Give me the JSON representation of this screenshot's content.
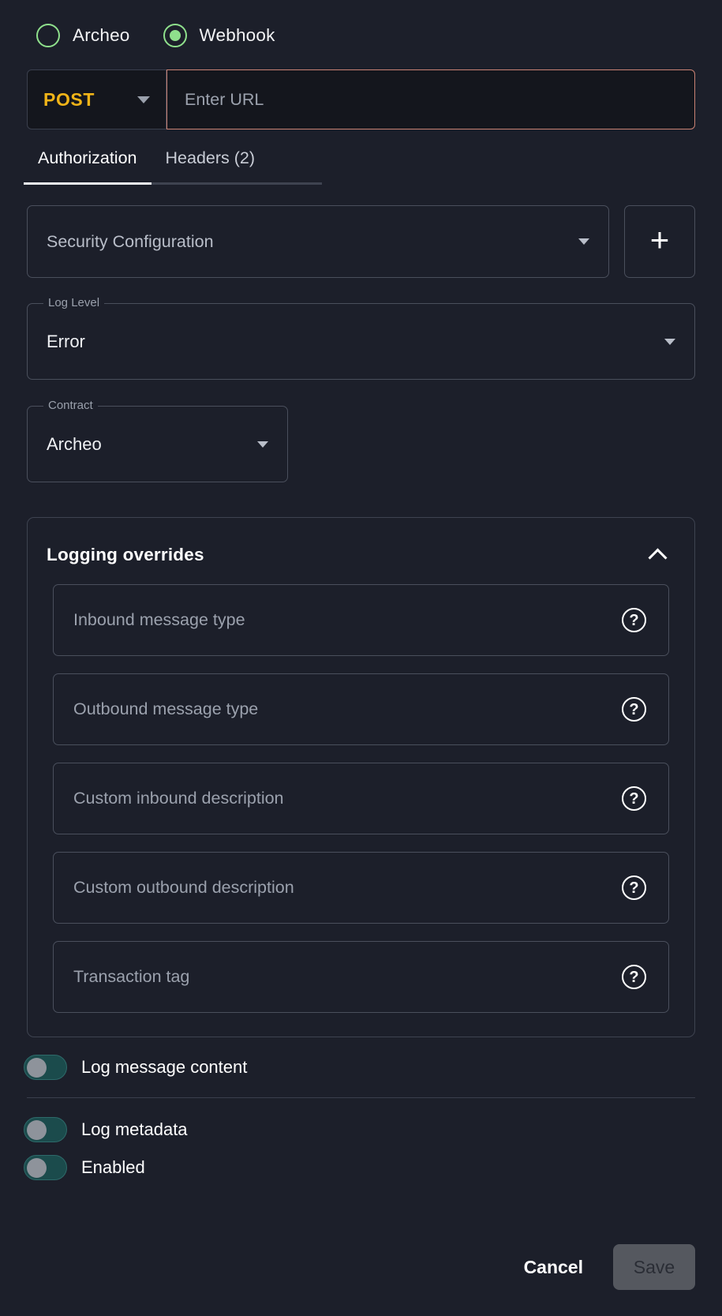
{
  "source_type": {
    "options": [
      {
        "label": "Archeo",
        "selected": false
      },
      {
        "label": "Webhook",
        "selected": true
      }
    ],
    "accent_color": "#8FE08C"
  },
  "request_bar": {
    "method": "POST",
    "method_color": "#F0B418",
    "url_value": "",
    "url_placeholder": "Enter URL",
    "url_border_color": "#C98274"
  },
  "tabs": [
    {
      "label": "Authorization",
      "active": true
    },
    {
      "label": "Headers (2)",
      "active": false
    }
  ],
  "security": {
    "select_placeholder": "Security Configuration",
    "add_label": "+"
  },
  "log_level": {
    "legend": "Log Level",
    "value": "Error"
  },
  "contract": {
    "legend": "Contract",
    "value": "Archeo"
  },
  "logging_overrides": {
    "title": "Logging overrides",
    "expanded": true,
    "fields": [
      {
        "placeholder": "Inbound message type",
        "value": "",
        "help": "?"
      },
      {
        "placeholder": "Outbound message type",
        "value": "",
        "help": "?"
      },
      {
        "placeholder": "Custom inbound description",
        "value": "",
        "help": "?"
      },
      {
        "placeholder": "Custom outbound description",
        "value": "",
        "help": "?"
      },
      {
        "placeholder": "Transaction tag",
        "value": "",
        "help": "?"
      }
    ]
  },
  "toggles": [
    {
      "label": "Log message content",
      "on": false
    },
    {
      "label": "Log metadata",
      "on": false
    },
    {
      "label": "Enabled",
      "on": false
    }
  ],
  "footer": {
    "cancel_label": "Cancel",
    "save_label": "Save",
    "save_disabled": true
  }
}
